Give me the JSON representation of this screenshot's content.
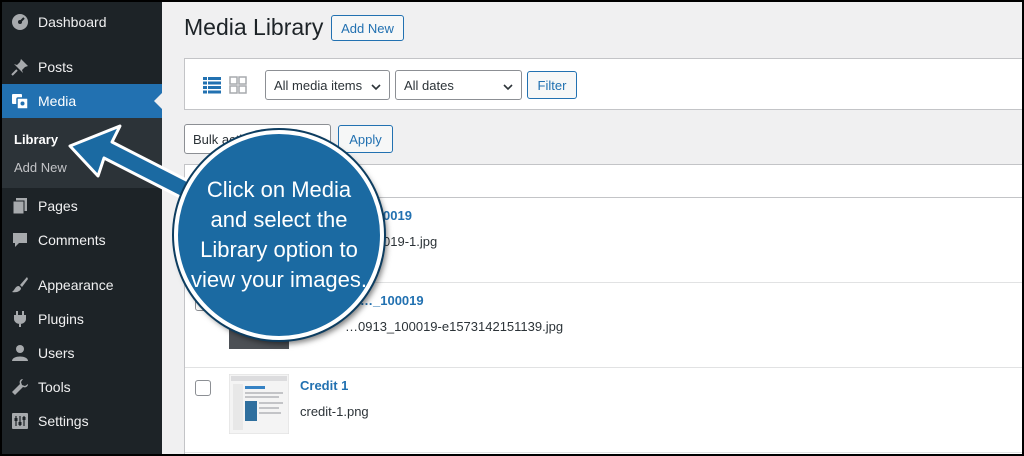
{
  "sidebar": {
    "items": [
      {
        "label": "Dashboard",
        "icon": "dashboard-icon"
      },
      {
        "label": "Posts",
        "icon": "pin-icon"
      },
      {
        "label": "Media",
        "icon": "media-icon"
      },
      {
        "label": "Pages",
        "icon": "pages-icon"
      },
      {
        "label": "Comments",
        "icon": "comment-icon"
      },
      {
        "label": "Appearance",
        "icon": "brush-icon"
      },
      {
        "label": "Plugins",
        "icon": "plug-icon"
      },
      {
        "label": "Users",
        "icon": "user-icon"
      },
      {
        "label": "Tools",
        "icon": "wrench-icon"
      },
      {
        "label": "Settings",
        "icon": "settings-icon"
      }
    ],
    "submenu": [
      {
        "label": "Library"
      },
      {
        "label": "Add New"
      }
    ]
  },
  "header": {
    "title": "Media Library",
    "add_new_label": "Add New"
  },
  "toolbar": {
    "media_filter": "All media items",
    "date_filter": "All dates",
    "filter_label": "Filter"
  },
  "bulk": {
    "select_value": "Bulk actions",
    "apply_label": "Apply"
  },
  "rows": [
    {
      "title": "…0019",
      "filename": "…019-1.jpg"
    },
    {
      "title": "…_100019",
      "filename": "…0913_100019-e1573142151139.jpg"
    },
    {
      "title": "Credit 1",
      "filename": "credit-1.png"
    }
  ],
  "callout": {
    "text": "Click on Media and select the Library option to view your images."
  },
  "colors": {
    "sidebar_bg": "#1d2327",
    "accent": "#2271b1",
    "callout_bg": "#1b6aa2"
  }
}
